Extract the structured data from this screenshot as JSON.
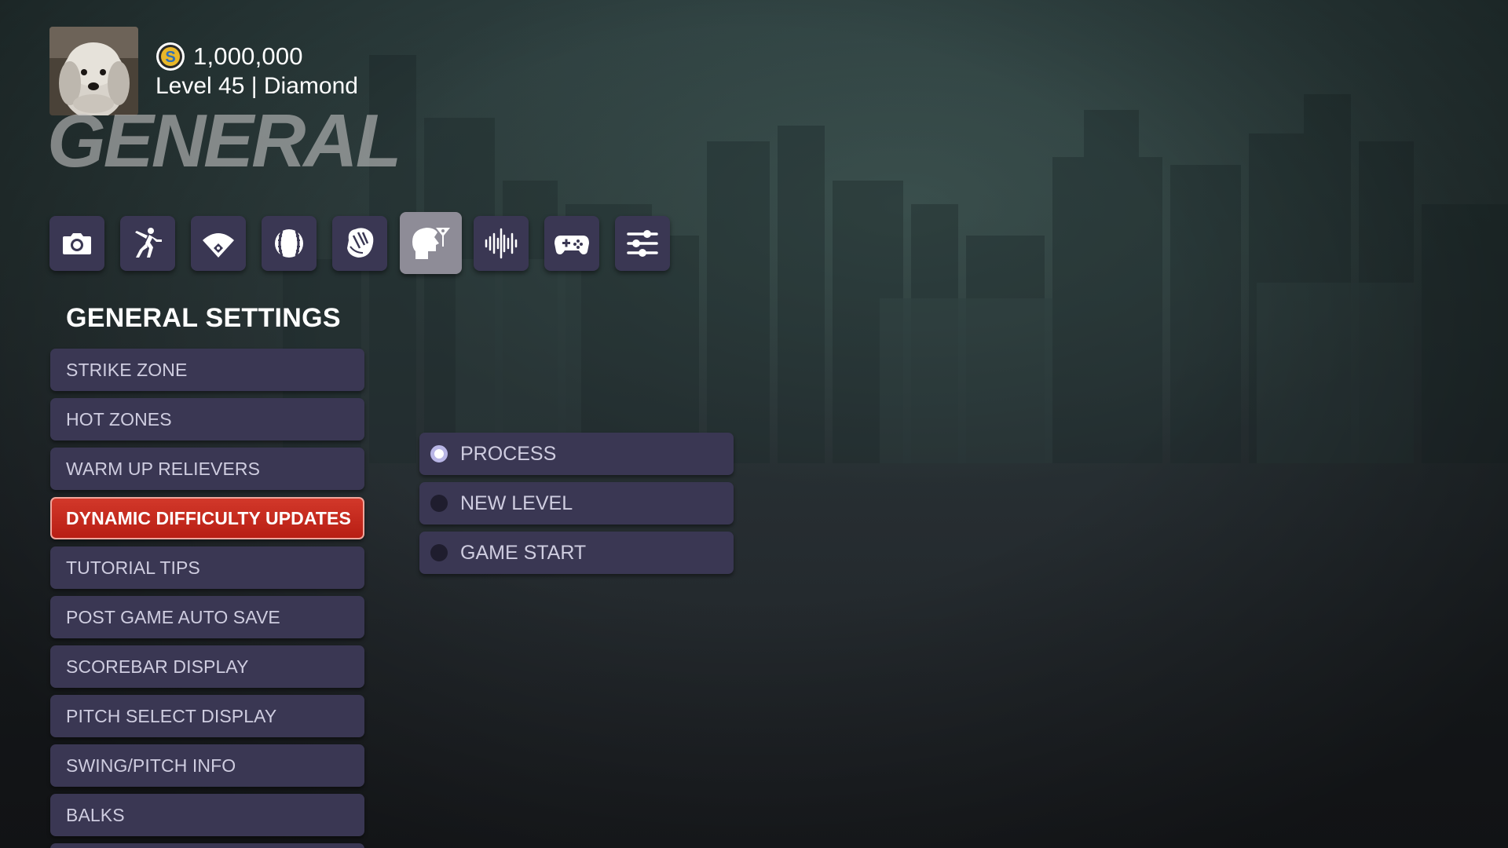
{
  "profile": {
    "coins": "1,000,000",
    "level": "Level 45 | Diamond",
    "coin_icon": "coin-s-icon",
    "avatar": "avatar-photo"
  },
  "page": {
    "title": "GENERAL"
  },
  "tabs": [
    {
      "icon": "camera-icon",
      "active": false
    },
    {
      "icon": "batter-player-icon",
      "active": false
    },
    {
      "icon": "baseball-field-icon",
      "active": false
    },
    {
      "icon": "baseball-icon",
      "active": false
    },
    {
      "icon": "glove-icon",
      "active": false
    },
    {
      "icon": "head-mixer-icon",
      "active": true
    },
    {
      "icon": "audio-waveform-icon",
      "active": false
    },
    {
      "icon": "gamepad-icon",
      "active": false
    },
    {
      "icon": "sliders-icon",
      "active": false
    }
  ],
  "section": {
    "heading": "GENERAL SETTINGS"
  },
  "menu": {
    "items": [
      "STRIKE ZONE",
      "HOT ZONES",
      "WARM UP RELIEVERS",
      "DYNAMIC DIFFICULTY UPDATES",
      "TUTORIAL TIPS",
      "POST GAME AUTO SAVE",
      "SCOREBAR DISPLAY",
      "PITCH SELECT DISPLAY",
      "SWING/PITCH INFO",
      "BALKS"
    ],
    "selected_index": 3
  },
  "options": {
    "items": [
      "PROCESS",
      "NEW LEVEL",
      "GAME START"
    ],
    "selected_index": 0
  },
  "colors": {
    "accent_red": "#c8281c",
    "button_bg": "#3a3753",
    "active_tab_bg": "#8e8c97",
    "radio_on": "#b9b6e6"
  }
}
